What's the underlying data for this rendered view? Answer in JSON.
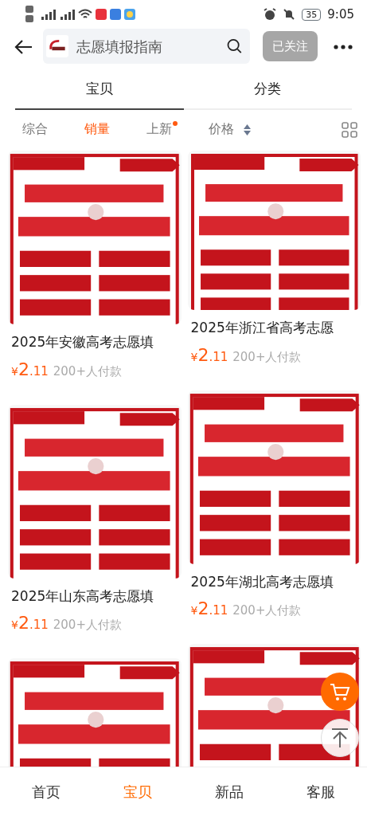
{
  "status_bar": {
    "battery": "35",
    "time": "9:05"
  },
  "header": {
    "search": {
      "value": "志愿填报指南"
    },
    "follow_button": {
      "label": "已关注",
      "disabled": true
    }
  },
  "tabs": [
    {
      "label": "宝贝",
      "selected": true
    },
    {
      "label": "分类",
      "selected": false
    }
  ],
  "sort_options": [
    {
      "label": "综合",
      "selected": false,
      "kind": "plain"
    },
    {
      "label": "销量",
      "selected": true,
      "kind": "plain"
    },
    {
      "label": "上新",
      "selected": false,
      "kind": "dot"
    },
    {
      "label": "价格",
      "selected": false,
      "kind": "sort"
    }
  ],
  "columns": [
    [
      {
        "kind": "product",
        "title": "2025年安徽高考志愿填",
        "price_symbol": "¥",
        "price_integer": "2",
        "price_decimal": ".11",
        "sales": "200+人付款"
      },
      {
        "kind": "product",
        "title": "2025年山东高考志愿填",
        "price_symbol": "¥",
        "price_integer": "2",
        "price_decimal": ".11",
        "sales": "200+人付款"
      },
      {
        "kind": "picture"
      }
    ],
    [
      {
        "kind": "product",
        "title": "2025年浙江省高考志愿",
        "price_symbol": "¥",
        "price_integer": "2",
        "price_decimal": ".11",
        "sales": "200+人付款"
      },
      {
        "kind": "product",
        "title": "2025年湖北高考志愿填",
        "price_symbol": "¥",
        "price_integer": "2",
        "price_decimal": ".11",
        "sales": "200+人付款"
      },
      {
        "kind": "picture"
      }
    ]
  ],
  "bottom_nav": [
    {
      "label": "首页",
      "selected": false
    },
    {
      "label": "宝贝",
      "selected": true
    },
    {
      "label": "新品",
      "selected": false
    },
    {
      "label": "客服",
      "selected": false
    }
  ]
}
